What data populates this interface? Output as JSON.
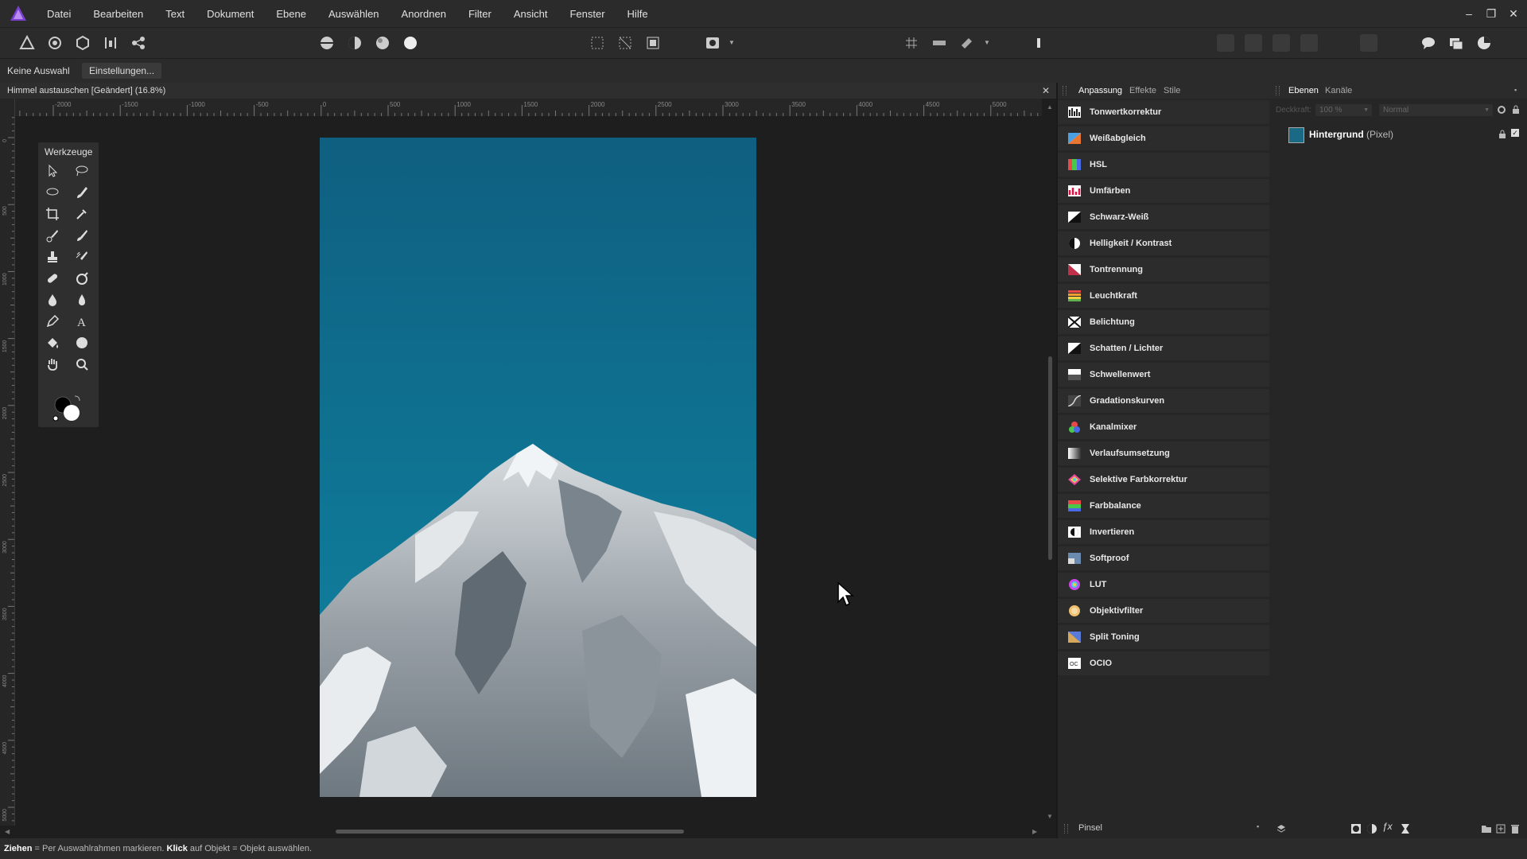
{
  "menubar": {
    "items": [
      "Datei",
      "Bearbeiten",
      "Text",
      "Dokument",
      "Ebene",
      "Auswählen",
      "Anordnen",
      "Filter",
      "Ansicht",
      "Fenster",
      "Hilfe"
    ],
    "window_controls": [
      "–",
      "❐",
      "✕"
    ]
  },
  "context": {
    "no_selection": "Keine Auswahl",
    "settings_button": "Einstellungen..."
  },
  "document": {
    "title": "Himmel austauschen [Geändert] (16.8%)",
    "close": "✕"
  },
  "rulers": {
    "unit": "px",
    "h_ticks": [
      "-2000",
      "-1500",
      "-1000",
      "-500",
      "0",
      "500",
      "1000",
      "1500",
      "2000",
      "2500",
      "3000",
      "3500",
      "4000",
      "4500",
      "5000"
    ],
    "v_ticks": [
      "0",
      "500",
      "1000",
      "1500",
      "2000",
      "2500",
      "3000",
      "3500",
      "4000",
      "4500",
      "5000"
    ]
  },
  "tools": {
    "title": "Werkzeuge",
    "items": [
      "move-tool",
      "lasso-tool",
      "freehand-selection-tool",
      "selection-brush-tool",
      "crop-tool",
      "color-picker-tool",
      "paint-brush-tool",
      "brush-tool",
      "clone-tool",
      "retouch-tool",
      "healing-tool",
      "dodge-tool",
      "smudge-tool",
      "blur-tool",
      "pen-tool",
      "text-tool",
      "flood-fill-tool",
      "shape-tool",
      "hand-tool",
      "zoom-tool"
    ]
  },
  "adjustments": {
    "tabs": [
      "Anpassung",
      "Effekte",
      "Stile"
    ],
    "active_tab": "Anpassung",
    "items": [
      {
        "label": "Tonwertkorrektur",
        "icon": "levels-icon"
      },
      {
        "label": "Weißabgleich",
        "icon": "white-balance-icon"
      },
      {
        "label": "HSL",
        "icon": "hsl-icon"
      },
      {
        "label": "Umfärben",
        "icon": "recolor-icon"
      },
      {
        "label": "Schwarz-Weiß",
        "icon": "black-white-icon"
      },
      {
        "label": "Helligkeit / Kontrast",
        "icon": "brightness-contrast-icon"
      },
      {
        "label": "Tontrennung",
        "icon": "posterize-icon"
      },
      {
        "label": "Leuchtkraft",
        "icon": "vibrance-icon"
      },
      {
        "label": "Belichtung",
        "icon": "exposure-icon"
      },
      {
        "label": "Schatten / Lichter",
        "icon": "shadows-highlights-icon"
      },
      {
        "label": "Schwellenwert",
        "icon": "threshold-icon"
      },
      {
        "label": "Gradationskurven",
        "icon": "curves-icon"
      },
      {
        "label": "Kanalmixer",
        "icon": "channel-mixer-icon"
      },
      {
        "label": "Verlaufsumsetzung",
        "icon": "gradient-map-icon"
      },
      {
        "label": "Selektive Farbkorrektur",
        "icon": "selective-color-icon"
      },
      {
        "label": "Farbbalance",
        "icon": "color-balance-icon"
      },
      {
        "label": "Invertieren",
        "icon": "invert-icon"
      },
      {
        "label": "Softproof",
        "icon": "soft-proof-icon"
      },
      {
        "label": "LUT",
        "icon": "lut-icon"
      },
      {
        "label": "Objektivfilter",
        "icon": "lens-filter-icon"
      },
      {
        "label": "Split Toning",
        "icon": "split-toning-icon"
      },
      {
        "label": "OCIO",
        "icon": "ocio-icon"
      }
    ],
    "footer_label": "Pinsel"
  },
  "layers": {
    "tabs": [
      "Ebenen",
      "Kanäle"
    ],
    "active_tab": "Ebenen",
    "opacity_label": "Deckkraft:",
    "opacity_value": "100 %",
    "blend_mode": "Normal",
    "layer_name": "Hintergrund",
    "layer_type": "(Pixel)"
  },
  "status": {
    "drag_bold": "Ziehen",
    "drag_text": " = Per Auswahlrahmen markieren. ",
    "click_bold": "Klick",
    "click_text": " auf Objekt = Objekt auswählen."
  },
  "colors": {
    "sky": "#0f6e8e",
    "panel_bg": "#262626",
    "app_bg": "#1e1e1e",
    "accent_logo": "#7b3fd1"
  }
}
